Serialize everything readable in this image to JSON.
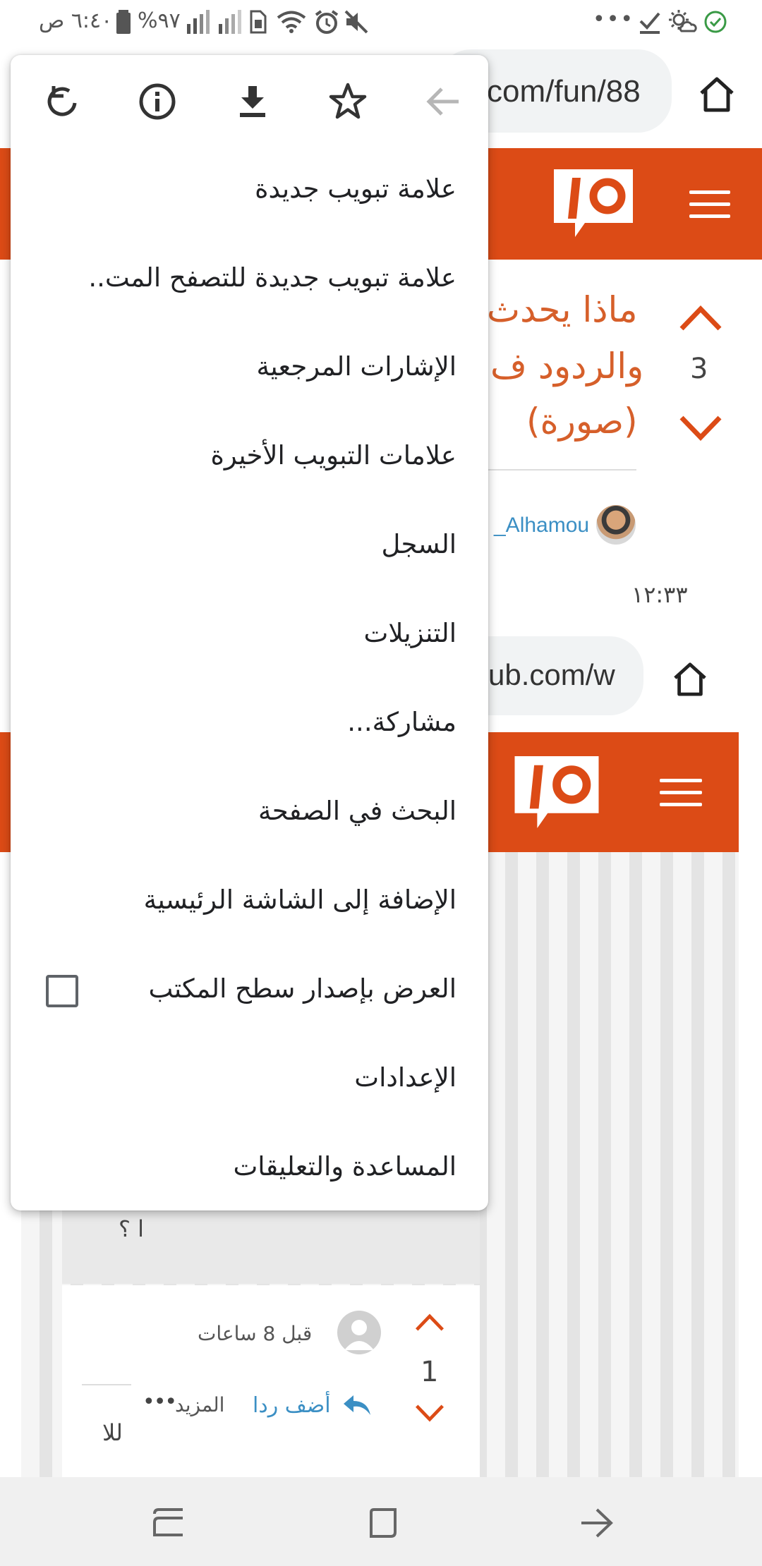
{
  "status_bar": {
    "time": "٦:٤٠ ص",
    "battery": "%٩٧",
    "icons": [
      "battery-icon",
      "signal-icon",
      "signal-icon",
      "sim-icon",
      "wifi-icon",
      "alarm-icon",
      "mute-icon",
      "more-icon",
      "check-icon",
      "weather-icon",
      "app-icon"
    ]
  },
  "browser": {
    "url_top": "com/fun/88",
    "url_second": "ub.com/w",
    "home_icon": "home-icon"
  },
  "page": {
    "post_title_lines": [
      "ماذا يحدث",
      "والردود ف",
      "(صورة)"
    ],
    "vote_count_top": "3",
    "author": "_Alhamou",
    "time": "١٢:٣٣",
    "comment_fragment": "ا ؟",
    "comment_time": "قبل 8 ساعات",
    "reply_label": "أضف ردا",
    "more_label": "المزيد",
    "vote_count_bottom": "1",
    "bottom_fragment": "للا"
  },
  "menu": {
    "toolbar": [
      "back-arrow-icon",
      "star-icon",
      "download-icon",
      "info-icon",
      "refresh-icon"
    ],
    "items": [
      {
        "label": "علامة تبويب جديدة"
      },
      {
        "label": "علامة تبويب جديدة للتصفح المت.."
      },
      {
        "label": "الإشارات المرجعية"
      },
      {
        "label": "علامات التبويب الأخيرة"
      },
      {
        "label": "السجل"
      },
      {
        "label": "التنزيلات"
      },
      {
        "label": "مشاركة..."
      },
      {
        "label": "البحث في الصفحة"
      },
      {
        "label": "الإضافة إلى الشاشة الرئيسية"
      },
      {
        "label": "العرض بإصدار سطح المكتب",
        "checked": false
      },
      {
        "label": "الإعدادات"
      },
      {
        "label": "المساعدة والتعليقات"
      }
    ]
  },
  "nav_bar": {
    "icons": [
      "recents-icon",
      "home-square-icon",
      "back-icon"
    ]
  },
  "colors": {
    "brand_orange": "#dc4b16",
    "title_orange": "#d65f2a",
    "link_blue": "#3b8fc4"
  }
}
